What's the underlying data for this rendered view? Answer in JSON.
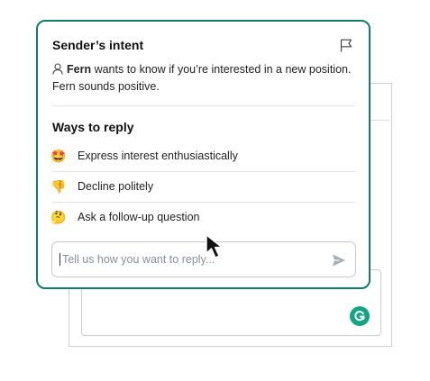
{
  "intent_panel": {
    "title": "Sender’s intent",
    "sender_name": "Fern",
    "intent_text": " wants to know if you’re interested in a new position. Fern sounds positive."
  },
  "reply_panel": {
    "title": "Ways to reply",
    "options": [
      {
        "emoji": "🤩",
        "label": "Express interest enthusiastically"
      },
      {
        "emoji": "👎",
        "label": "Decline politely"
      },
      {
        "emoji": "🤔",
        "label": "Ask a follow-up question"
      }
    ]
  },
  "reply_input": {
    "placeholder": "Tell us how you want to reply..."
  },
  "colors": {
    "accent": "#117d6b",
    "brand_logo": "#11a683",
    "send_icon": "#a9adb3"
  },
  "icons": [
    "person-icon",
    "flag-icon",
    "send-icon",
    "grammarly-logo-icon",
    "mouse-cursor-icon"
  ]
}
